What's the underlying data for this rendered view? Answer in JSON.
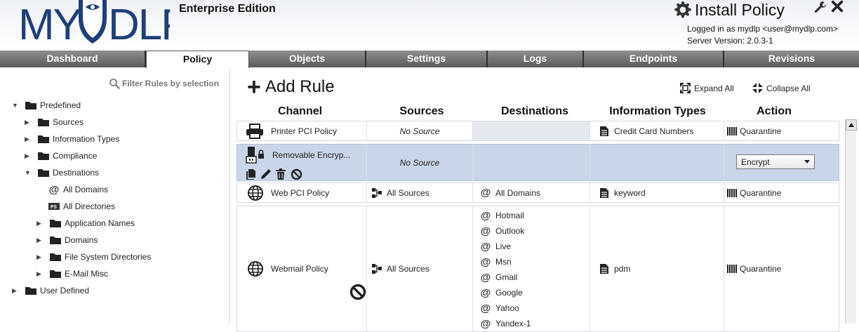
{
  "header": {
    "logo_text": "MYDLP",
    "edition": "Enterprise Edition",
    "install_policy": "Install Policy",
    "logged_in": "Logged in as mydlp <user@mydlp.com>",
    "server_version": "Server Version: 2.0.3-1"
  },
  "tabs": [
    "Dashboard",
    "Policy",
    "Objects",
    "Settings",
    "Logs",
    "Endpoints",
    "Revisions"
  ],
  "active_tab": "Policy",
  "left": {
    "filter_label": "Filter Rules by selection",
    "tree": {
      "predefined": "Predefined",
      "sources": "Sources",
      "information_types": "Information Types",
      "compliance": "Compliance",
      "destinations": "Destinations",
      "all_domains": "All Domains",
      "all_directories": "All Directories",
      "application_names": "Application Names",
      "domains": "Domains",
      "file_system_directories": "File System Directories",
      "email_misc": "E-Mail Misc",
      "user_defined": "User Defined"
    }
  },
  "main": {
    "add_rule": "Add Rule",
    "expand_all": "Expand All",
    "collapse_all": "Collapse All",
    "columns": [
      "Channel",
      "Sources",
      "Destinations",
      "Information Types",
      "Action"
    ],
    "rules": [
      {
        "name": "Printer PCI Policy",
        "source": "No Source",
        "destination": "",
        "info_type": "Credit Card Numbers",
        "action": "Quarantine"
      },
      {
        "name": "Removable Encryp...",
        "source": "No Source",
        "destination": "",
        "info_type": "",
        "action": "Encrypt"
      },
      {
        "name": "Web PCI Policy",
        "source": "All Sources",
        "destination": "All Domains",
        "info_type": "keyword",
        "action": "Quarantine"
      },
      {
        "name": "Webmail Policy",
        "source": "All Sources",
        "destinations": [
          "Hotmail",
          "Outlook",
          "Live",
          "Msn",
          "Gmail",
          "Google",
          "Yahoo",
          "Yandex-1"
        ],
        "info_type": "pdm",
        "action": "Quarantine"
      }
    ]
  }
}
